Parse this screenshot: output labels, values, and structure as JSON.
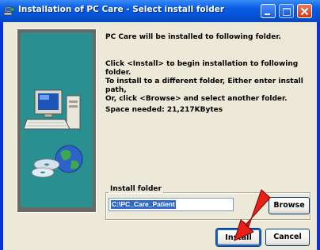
{
  "window": {
    "title": "Installation of PC Care - Select install folder",
    "icon": "installer-icon"
  },
  "content": {
    "heading": "PC Care will be installed to following folder.",
    "instructions": [
      "Click <Install> to begin installation to following folder.",
      "To install to a different folder, Either enter install path,",
      "Or, click <Browse> and select another folder."
    ],
    "space_needed": "Space needed: 21,217KBytes"
  },
  "install_folder": {
    "label": "Install folder",
    "value": "C:\\PC_Care_Patient"
  },
  "buttons": {
    "browse": "Browse",
    "install": "Install",
    "cancel": "Cancel"
  },
  "colors": {
    "title_bar": "#0553d6",
    "dialog_bg": "#ece9d8",
    "art_bg": "#2a8f91",
    "selection": "#316ac5",
    "arrow": "#e8201a"
  }
}
